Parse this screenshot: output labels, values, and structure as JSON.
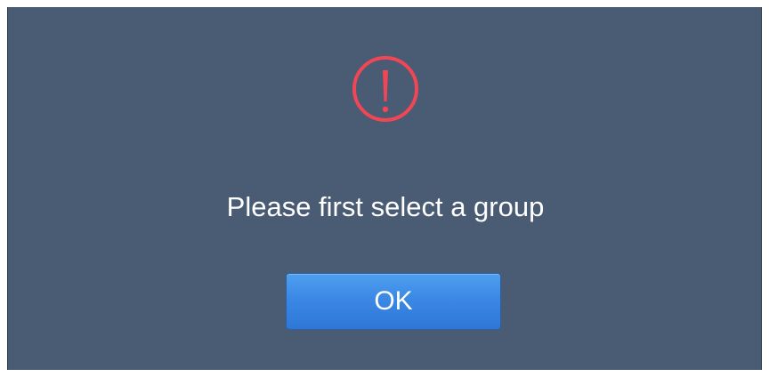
{
  "dialog": {
    "icon": "exclamation-circle-icon",
    "message": "Please first select a group",
    "ok_label": "OK"
  },
  "colors": {
    "background": "#4a5b74",
    "icon": "#f04655",
    "button": "#3a87e4",
    "text": "#ffffff"
  }
}
